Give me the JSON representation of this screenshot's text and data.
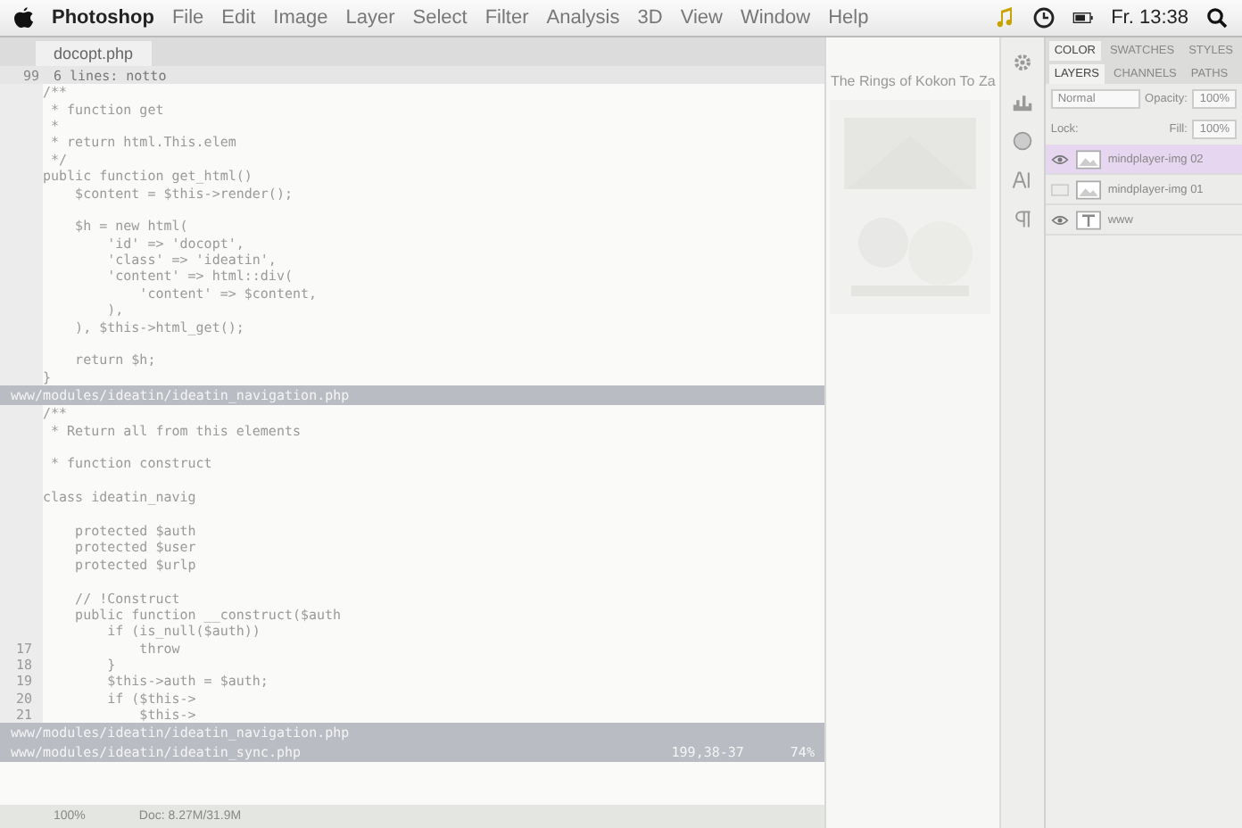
{
  "menubar": {
    "app": "Photoshop",
    "menus": [
      "File",
      "Edit",
      "Image",
      "Layer",
      "Select",
      "Filter",
      "Analysis",
      "3D",
      "View",
      "Window",
      "Help"
    ],
    "clock": "Fr. 13:38"
  },
  "editor": {
    "tab": "docopt.php",
    "fold": {
      "number": "99",
      "text": "6 lines: notto"
    },
    "lines": [
      {
        "kind": "code",
        "text": "/**"
      },
      {
        "kind": "code",
        "text": " * function get"
      },
      {
        "kind": "code",
        "text": " *"
      },
      {
        "kind": "code",
        "text": " * return html.This.elem"
      },
      {
        "kind": "code",
        "text": " */"
      },
      {
        "kind": "code",
        "text": "public function get_html()"
      },
      {
        "kind": "code",
        "text": "    $content = $this->render();"
      },
      {
        "kind": "blank"
      },
      {
        "kind": "code",
        "text": "    $h = new html("
      },
      {
        "kind": "code",
        "text": "        'id' => 'docopt',"
      },
      {
        "kind": "code",
        "text": "        'class' => 'ideatin',"
      },
      {
        "kind": "code",
        "text": "        'content' => html::div("
      },
      {
        "kind": "code",
        "text": "            'content' => $content,"
      },
      {
        "kind": "code",
        "text": "        ),"
      },
      {
        "kind": "code",
        "text": "    ), $this->html_get();"
      },
      {
        "kind": "blank"
      },
      {
        "kind": "code",
        "text": "    return $h;"
      },
      {
        "kind": "code",
        "text": "}"
      }
    ],
    "split": {
      "path": "www/modules/ideatin/ideatin_navigation.php"
    },
    "lines2": [
      {
        "kind": "code",
        "text": "/**"
      },
      {
        "kind": "code",
        "text": " * Return all from this elements"
      },
      {
        "kind": "blank"
      },
      {
        "kind": "code",
        "text": " * function construct"
      },
      {
        "kind": "blank"
      },
      {
        "kind": "code",
        "text": "class ideatin_navig"
      },
      {
        "kind": "blank"
      },
      {
        "kind": "code",
        "text": "    protected $auth"
      },
      {
        "kind": "code",
        "text": "    protected $user"
      },
      {
        "kind": "code",
        "text": "    protected $urlp"
      },
      {
        "kind": "blank"
      },
      {
        "kind": "code",
        "text": "    // !Construct"
      },
      {
        "kind": "code",
        "text": "    public function __construct($auth"
      },
      {
        "kind": "code",
        "text": "        if (is_null($auth))"
      },
      {
        "kind": "code",
        "number": "17",
        "text": "            throw"
      },
      {
        "kind": "code",
        "number": "18",
        "text": "        }"
      },
      {
        "kind": "code",
        "number": "19",
        "text": "        $this->auth = $auth;"
      },
      {
        "kind": "code",
        "number": "20",
        "text": "        if ($this->"
      },
      {
        "kind": "code",
        "number": "21",
        "text": "            $this->"
      }
    ],
    "status_lines": [
      {
        "path": "www/modules/ideatin/ideatin_navigation.php"
      },
      {
        "path": "www/modules/ideatin/ideatin_sync.php",
        "position": "199,38-37",
        "percent": "74%"
      }
    ],
    "zoom": "100%",
    "doc": "Doc: 8.27M/31.9M"
  },
  "browser": {
    "heading": "The Rings of Kokon To Za"
  },
  "panel": {
    "top_tabs": [
      {
        "label": "COLOR",
        "selected": true
      },
      {
        "label": "SWATCHES",
        "selected": false
      },
      {
        "label": "STYLES",
        "selected": false
      }
    ],
    "tabs": [
      {
        "label": "LAYERS",
        "selected": true
      },
      {
        "label": "CHANNELS",
        "selected": false
      },
      {
        "label": "PATHS",
        "selected": false
      }
    ],
    "blend": "Normal",
    "opacity_label": "Opacity:",
    "opacity": "100%",
    "lock_label": "Lock:",
    "fill_label": "Fill:",
    "fill": "100%",
    "layers": [
      {
        "name": "mindplayer-img 02",
        "visible": true,
        "selected": true
      },
      {
        "name": "mindplayer-img 01",
        "visible": false,
        "selected": false
      },
      {
        "name": "www",
        "visible": true,
        "selected": false,
        "kind": "text"
      }
    ]
  }
}
